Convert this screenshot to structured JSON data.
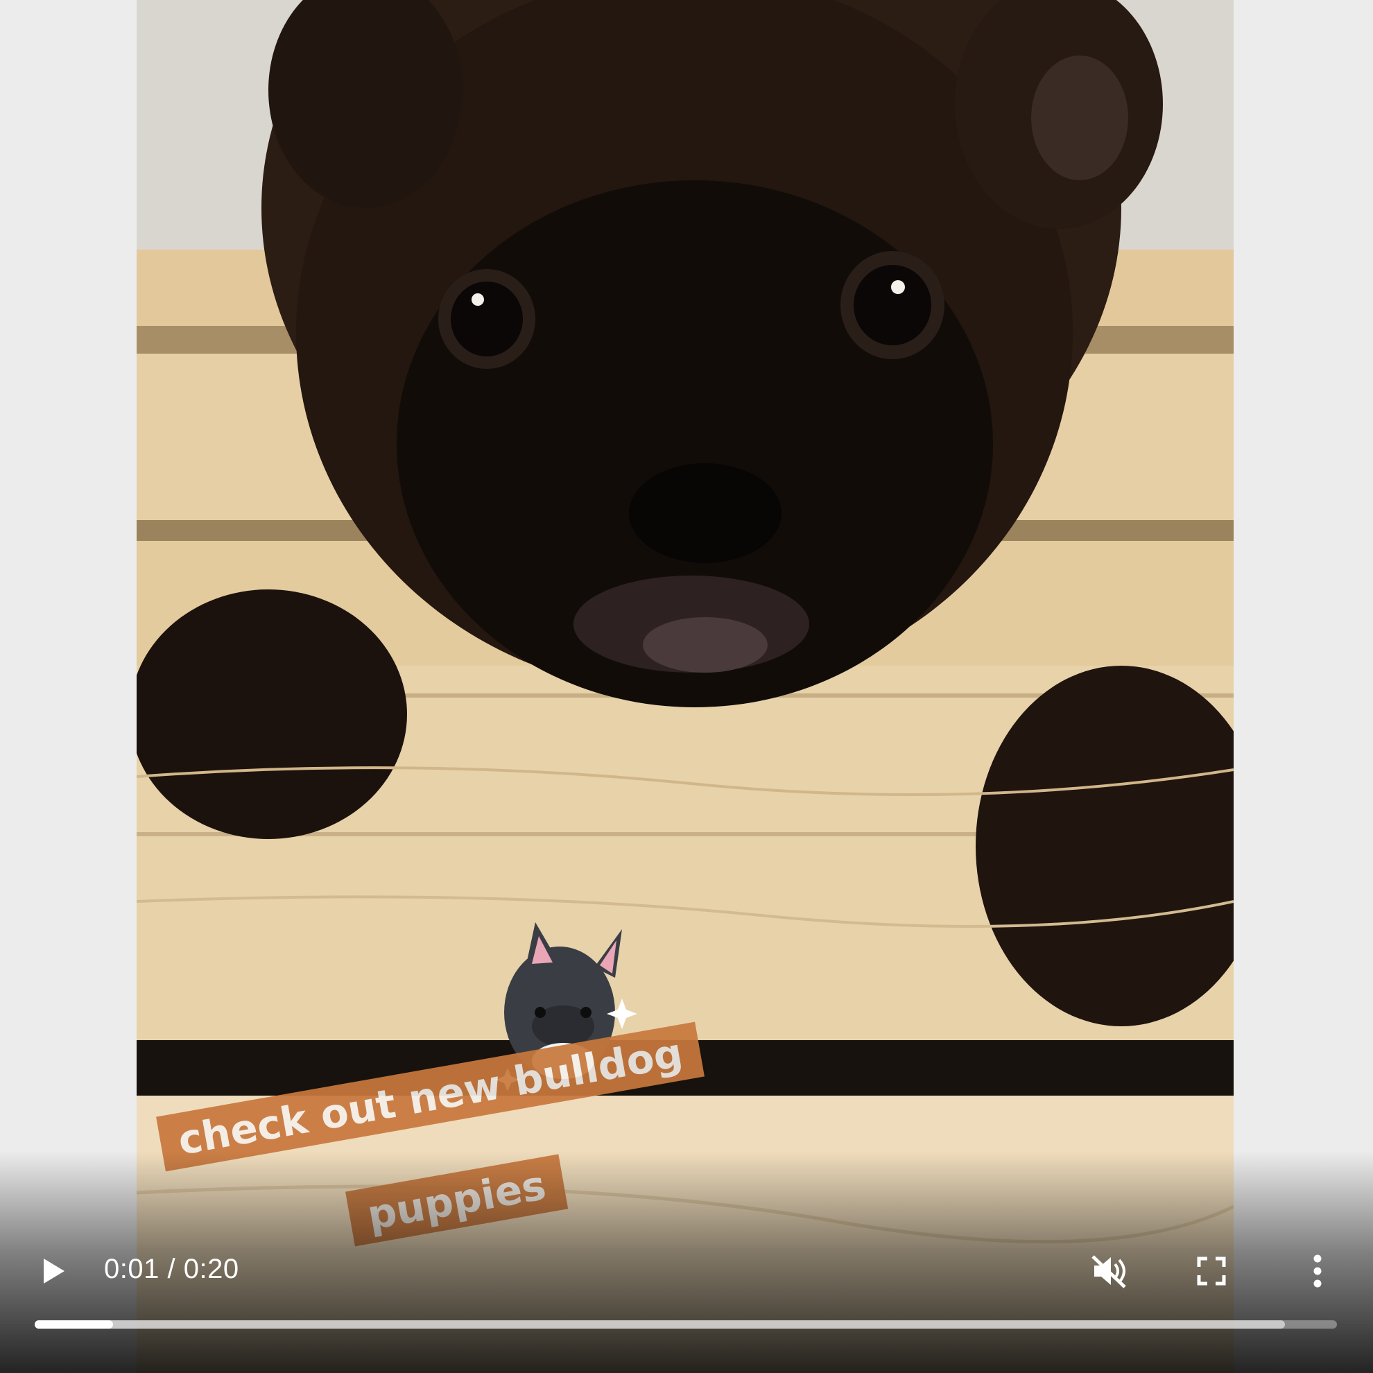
{
  "video": {
    "caption_line_1": "check out new bulldog",
    "caption_line_2": "puppies"
  },
  "controls": {
    "current_time": "0:01",
    "separator": "/",
    "duration": "0:20",
    "muted": true,
    "progress_fraction": 0.06,
    "buffered_fraction": 0.96,
    "icons": {
      "play": "play-icon",
      "mute": "volume-muted-icon",
      "fullscreen": "fullscreen-icon",
      "more": "more-vertical-icon"
    }
  },
  "colors": {
    "caption_bg": "#c8783c",
    "caption_text": "#f4efe9",
    "control_fg": "#ffffff"
  }
}
